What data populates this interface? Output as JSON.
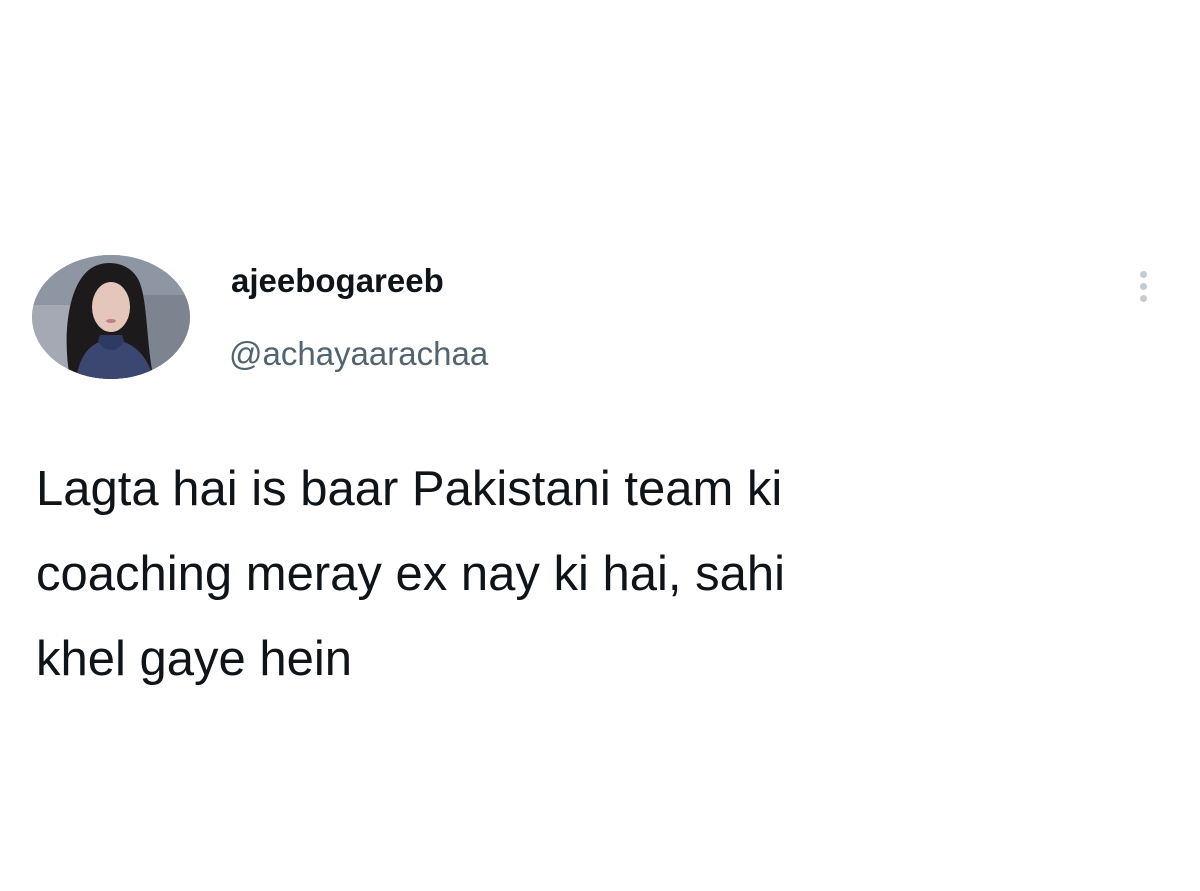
{
  "tweet": {
    "author": {
      "display_name": "ajeebogareeb",
      "handle": "@achayaarachaa",
      "avatar": "profile-photo"
    },
    "text_lines": [
      "Lagta hai is baar Pakistani team ki",
      "coaching meray ex nay ki hai, sahi",
      "khel gaye hein"
    ],
    "more_icon": "more-vertical-icon"
  },
  "colors": {
    "background": "#ffffff",
    "primary_text": "#0f1419",
    "secondary_text": "#536471",
    "icon": "#c4cbd1"
  }
}
